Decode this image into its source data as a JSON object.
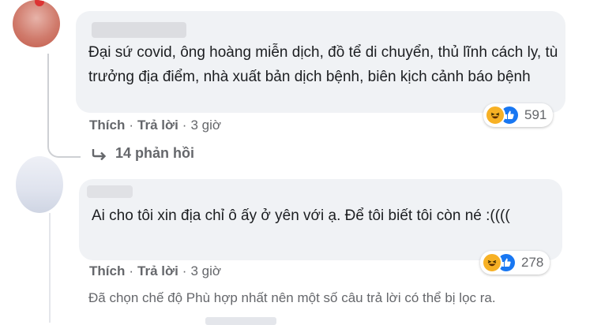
{
  "comment1": {
    "text": "Đại sứ covid, ông hoàng miễn dịch, đồ tể di chuyển, thủ lĩnh cách ly, tù trưởng địa điểm, nhà xuất bản dịch bệnh, biên kịch cảnh báo bệnh",
    "reactions": {
      "icons": [
        "haha-icon",
        "like-icon"
      ],
      "count": "591"
    },
    "actions": {
      "like": "Thích",
      "reply": "Trả lời",
      "time": "3 giờ",
      "separator": "·"
    },
    "replies_label": "14 phản hồi"
  },
  "comment2": {
    "text": "Ai cho tôi xin địa chỉ ô ấy ở yên với ạ. Để tôi biết tôi còn né :((((",
    "reactions": {
      "icons": [
        "haha-icon",
        "like-icon"
      ],
      "count": "278"
    },
    "actions": {
      "like": "Thích",
      "reply": "Trả lời",
      "time": "3 giờ",
      "separator": "·"
    }
  },
  "filter_note": "Đã chọn chế độ Phù hợp nhất nên một số câu trả lời có thể bị lọc ra.",
  "colors": {
    "bubble": "#f0f2f5",
    "like_blue": "#1877f2",
    "haha_yellow": "#f7b125",
    "meta_gray": "#65676b"
  }
}
